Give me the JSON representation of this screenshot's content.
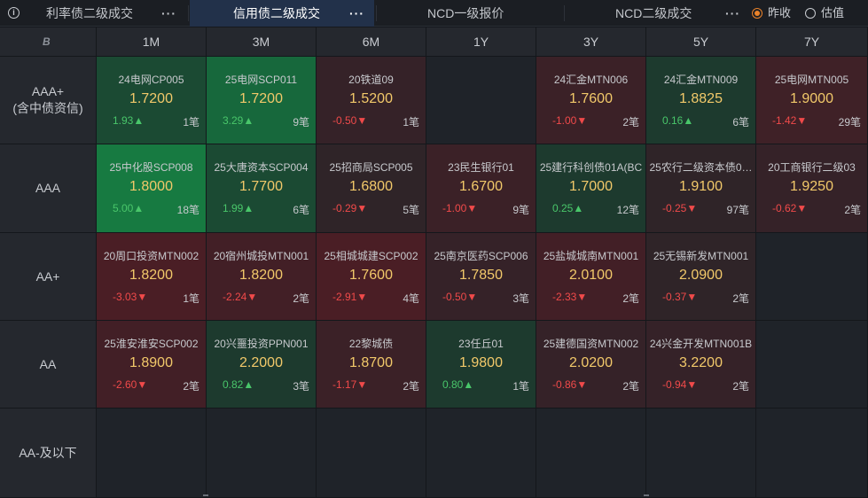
{
  "toolbar": {
    "info_icon": "i",
    "tabs": [
      {
        "label": "利率债二级成交",
        "more": "···",
        "active": false
      },
      {
        "label": "信用债二级成交",
        "more": "···",
        "active": true
      },
      {
        "label": "NCD一级报价",
        "more": "",
        "active": false
      },
      {
        "label": "NCD二级成交",
        "more": "···",
        "active": false
      }
    ],
    "radios": [
      {
        "label": "昨收",
        "selected": true
      },
      {
        "label": "估值",
        "selected": false
      }
    ]
  },
  "grid": {
    "corner_icon": "B",
    "columns": [
      "1M",
      "3M",
      "6M",
      "1Y",
      "3Y",
      "5Y",
      "7Y"
    ],
    "rows": [
      {
        "label": "AAA+",
        "sub": "(含中债资信)"
      },
      {
        "label": "AAA",
        "sub": ""
      },
      {
        "label": "AA+",
        "sub": ""
      },
      {
        "label": "AA",
        "sub": ""
      },
      {
        "label": "AA-及以下",
        "sub": ""
      }
    ],
    "cells": [
      [
        {
          "name": "24电网CP005",
          "rate": "1.7200",
          "change": "1.93▲",
          "count": "1笔",
          "dir": "up",
          "bg": "#1b4a33"
        },
        {
          "name": "25电网SCP011",
          "rate": "1.7200",
          "change": "3.29▲",
          "count": "9笔",
          "dir": "up",
          "bg": "#17683c"
        },
        {
          "name": "20铁道09",
          "rate": "1.5200",
          "change": "-0.50▼",
          "count": "1笔",
          "dir": "down",
          "bg": "#352228"
        },
        null,
        {
          "name": "24汇金MTN006",
          "rate": "1.7600",
          "change": "-1.00▼",
          "count": "2笔",
          "dir": "down",
          "bg": "#3b2127"
        },
        {
          "name": "24汇金MTN009",
          "rate": "1.8825",
          "change": "0.16▲",
          "count": "6笔",
          "dir": "up",
          "bg": "#1d3a2e"
        },
        {
          "name": "25电网MTN005",
          "rate": "1.9000",
          "change": "-1.42▼",
          "count": "29笔",
          "dir": "down",
          "bg": "#3f2127"
        }
      ],
      [
        {
          "name": "25中化股SCP008",
          "rate": "1.8000",
          "change": "5.00▲",
          "count": "18笔",
          "dir": "up",
          "bg": "#177a41"
        },
        {
          "name": "25大唐资本SCP004",
          "rate": "1.7700",
          "change": "1.99▲",
          "count": "6笔",
          "dir": "up",
          "bg": "#1b4a33"
        },
        {
          "name": "25招商局SCP005",
          "rate": "1.6800",
          "change": "-0.29▼",
          "count": "5笔",
          "dir": "down",
          "bg": "#2f2428"
        },
        {
          "name": "23民生银行01",
          "rate": "1.6700",
          "change": "-1.00▼",
          "count": "9笔",
          "dir": "down",
          "bg": "#3b2127"
        },
        {
          "name": "25建行科创债01A(BC",
          "rate": "1.7000",
          "change": "0.25▲",
          "count": "12笔",
          "dir": "up",
          "bg": "#1d3a2e"
        },
        {
          "name": "25农行二级资本债0…",
          "rate": "1.9100",
          "change": "-0.25▼",
          "count": "97笔",
          "dir": "down",
          "bg": "#2f2428"
        },
        {
          "name": "20工商银行二级03",
          "rate": "1.9250",
          "change": "-0.62▼",
          "count": "2笔",
          "dir": "down",
          "bg": "#352228"
        }
      ],
      [
        {
          "name": "20周口投资MTN002",
          "rate": "1.8200",
          "change": "-3.03▼",
          "count": "1笔",
          "dir": "down",
          "bg": "#4a1e25"
        },
        {
          "name": "20宿州城投MTN001",
          "rate": "1.8200",
          "change": "-2.24▼",
          "count": "2笔",
          "dir": "down",
          "bg": "#421f26"
        },
        {
          "name": "25相城城建SCP002",
          "rate": "1.7600",
          "change": "-2.91▼",
          "count": "4笔",
          "dir": "down",
          "bg": "#4a1e25"
        },
        {
          "name": "25南京医药SCP006",
          "rate": "1.7850",
          "change": "-0.50▼",
          "count": "3笔",
          "dir": "down",
          "bg": "#352228"
        },
        {
          "name": "25盐城城南MTN001",
          "rate": "2.0100",
          "change": "-2.33▼",
          "count": "2笔",
          "dir": "down",
          "bg": "#421f26"
        },
        {
          "name": "25无锡新发MTN001",
          "rate": "2.0900",
          "change": "-0.37▼",
          "count": "2笔",
          "dir": "down",
          "bg": "#2f2428"
        },
        null
      ],
      [
        {
          "name": "25淮安淮安SCP002",
          "rate": "1.8900",
          "change": "-2.60▼",
          "count": "2笔",
          "dir": "down",
          "bg": "#421f26"
        },
        {
          "name": "20兴噩投资PPN001",
          "rate": "2.2000",
          "change": "0.82▲",
          "count": "3笔",
          "dir": "up",
          "bg": "#1d3a2e"
        },
        {
          "name": "22黎城债",
          "rate": "1.8700",
          "change": "-1.17▼",
          "count": "2笔",
          "dir": "down",
          "bg": "#3b2127"
        },
        {
          "name": "23任丘01",
          "rate": "1.9800",
          "change": "0.80▲",
          "count": "1笔",
          "dir": "up",
          "bg": "#1d3a2e"
        },
        {
          "name": "25建德国资MTN002",
          "rate": "2.0200",
          "change": "-0.86▼",
          "count": "2笔",
          "dir": "down",
          "bg": "#352228"
        },
        {
          "name": "24兴金开发MTN001B",
          "rate": "3.2200",
          "change": "-0.94▼",
          "count": "2笔",
          "dir": "down",
          "bg": "#352228"
        },
        null
      ],
      [
        null,
        null,
        null,
        null,
        null,
        null,
        null
      ]
    ]
  }
}
